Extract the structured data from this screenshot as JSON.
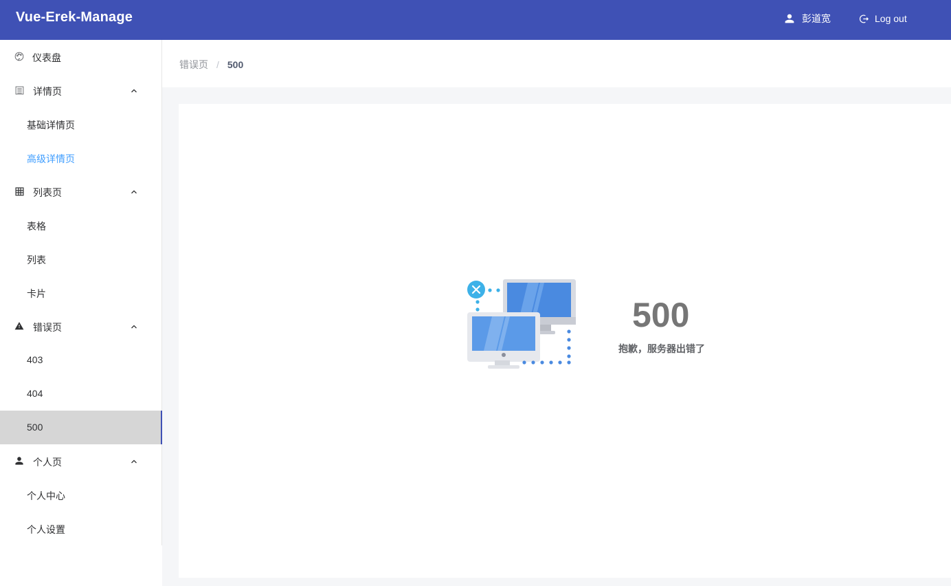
{
  "header": {
    "app_title": "Vue-Erek-Manage",
    "user_name": "彭道宽",
    "logout_label": "Log out"
  },
  "sidebar": {
    "dashboard": "仪表盘",
    "detail": {
      "label": "详情页",
      "items": [
        "基础详情页",
        "高级详情页"
      ]
    },
    "list": {
      "label": "列表页",
      "items": [
        "表格",
        "列表",
        "卡片"
      ]
    },
    "error": {
      "label": "错误页",
      "items": [
        "403",
        "404",
        "500"
      ]
    },
    "personal": {
      "label": "个人页",
      "items": [
        "个人中心",
        "个人设置"
      ]
    }
  },
  "breadcrumb": {
    "parent": "错误页",
    "separator": "/",
    "current": "500"
  },
  "error_page": {
    "code": "500",
    "message": "抱歉，服务器出错了"
  },
  "colors": {
    "header_bg": "#3f51b5",
    "active_link": "#409eff",
    "selected_bg": "#d6d6d6"
  }
}
